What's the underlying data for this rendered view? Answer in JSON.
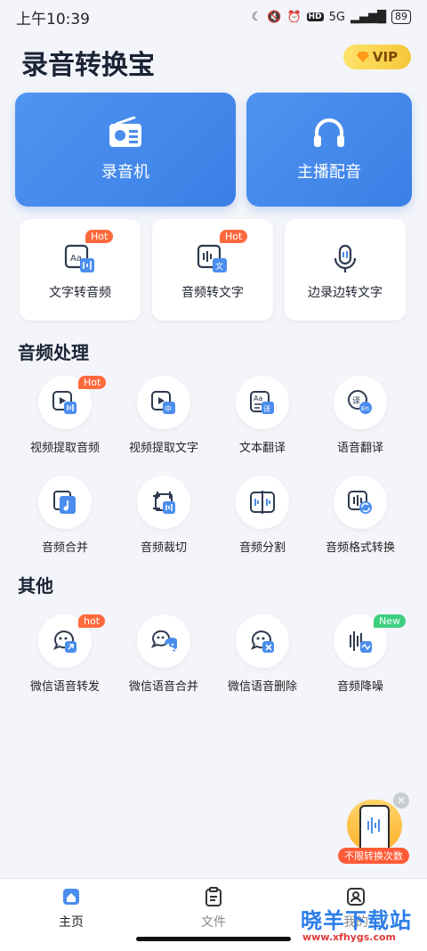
{
  "status": {
    "time": "上午10:39",
    "network": "5G",
    "battery": "89"
  },
  "header": {
    "title": "录音转换宝",
    "vip_label": "VIP"
  },
  "big_cards": [
    {
      "label": "录音机",
      "icon": "radio-icon"
    },
    {
      "label": "主播配音",
      "icon": "headphones-icon"
    }
  ],
  "feature_cards": [
    {
      "label": "文字转音频",
      "badge": "Hot",
      "icon": "text-to-audio-icon"
    },
    {
      "label": "音频转文字",
      "badge": "Hot",
      "icon": "audio-to-text-icon"
    },
    {
      "label": "边录边转文字",
      "icon": "microphone-icon"
    }
  ],
  "audio_section": {
    "title": "音频处理",
    "items": [
      {
        "label": "视频提取音频",
        "badge": "Hot",
        "icon": "video-audio-icon"
      },
      {
        "label": "视频提取文字",
        "icon": "video-text-icon"
      },
      {
        "label": "文本翻译",
        "icon": "text-translate-icon"
      },
      {
        "label": "语音翻译",
        "icon": "voice-translate-icon"
      },
      {
        "label": "音频合并",
        "icon": "audio-merge-icon"
      },
      {
        "label": "音频裁切",
        "icon": "audio-cut-icon"
      },
      {
        "label": "音频分割",
        "icon": "audio-split-icon"
      },
      {
        "label": "音频格式转换",
        "icon": "audio-convert-icon"
      }
    ]
  },
  "other_section": {
    "title": "其他",
    "items": [
      {
        "label": "微信语音转发",
        "badge": "hot",
        "icon": "wechat-forward-icon"
      },
      {
        "label": "微信语音合并",
        "icon": "wechat-merge-icon"
      },
      {
        "label": "微信语音删除",
        "icon": "wechat-delete-icon"
      },
      {
        "label": "音频降噪",
        "badge": "New",
        "icon": "noise-reduction-icon"
      }
    ]
  },
  "floating_promo": {
    "label": "不限转换次数"
  },
  "tabs": [
    {
      "label": "主页",
      "icon": "home-icon",
      "active": true
    },
    {
      "label": "文件",
      "icon": "clipboard-icon"
    },
    {
      "label": "我的",
      "icon": "user-icon"
    }
  ],
  "watermark": {
    "text": "晓羊下载站",
    "url": "www.xfhygs.com"
  }
}
